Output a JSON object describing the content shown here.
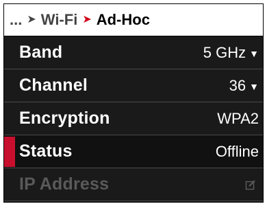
{
  "header": {
    "ellipsis": "...",
    "parent": "Wi-Fi",
    "current": "Ad-Hoc"
  },
  "rows": [
    {
      "label": "Band",
      "value": "5 GHz",
      "icon": "chevron-down-icon"
    },
    {
      "label": "Channel",
      "value": "36",
      "icon": "chevron-down-icon"
    },
    {
      "label": "Encryption",
      "value": "WPA2"
    },
    {
      "label": "Status",
      "value": "Offline",
      "selected": true
    },
    {
      "label": "IP Address",
      "icon": "edit-icon",
      "disabled": true
    }
  ],
  "colors": {
    "accent": "#c8102e",
    "background": "#1a1a1a",
    "disabled_text": "#5a5a5a"
  }
}
